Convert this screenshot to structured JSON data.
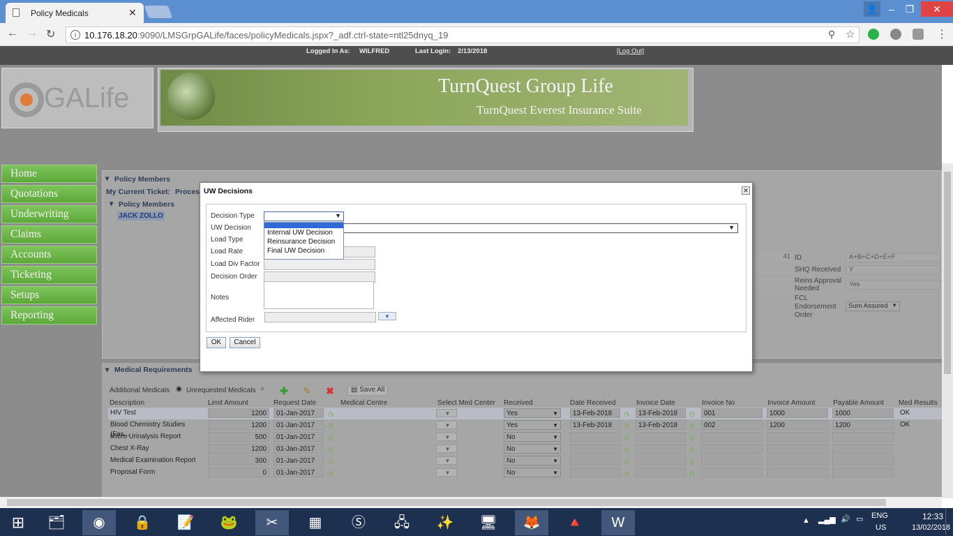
{
  "browser": {
    "tab_title": "Policy Medicals",
    "url_host": "10.176.18.20",
    "url_rest": ":9090/LMSGrpGALife/faces/policyMedicals.jspx?_adf.ctrl-state=ntl25dnyq_19"
  },
  "header": {
    "logged_in_label": "Logged In As:",
    "user": "WILFRED",
    "last_login_label": "Last Login:",
    "last_login": "2/13/2018",
    "logout": "[Log Out]",
    "logo_text": "GALife",
    "banner_title": "TurnQuest Group Life",
    "banner_sub": "TurnQuest Everest Insurance Suite"
  },
  "sidebar": {
    "items": [
      "Home",
      "Quotations",
      "Underwriting",
      "Claims",
      "Accounts",
      "Ticketing",
      "Setups",
      "Reporting"
    ]
  },
  "panel": {
    "title": "Policy Members",
    "ticket_label": "My Current Ticket:",
    "ticket_value": "Process",
    "members_title": "Policy Members",
    "member": "JACK ZOLLO",
    "right_fields": {
      "val41": "41",
      "id_label": "ID",
      "id_value": "A+B+C+D+E+F",
      "shq_label": "SHQ Received",
      "shq_value": "Y",
      "reins_label": "Reins Approval Needed",
      "reins_value": "Yes",
      "fcl_label": "FCL Endorsement Order",
      "fcl_value": "Sum Assured"
    }
  },
  "medical": {
    "title": "Medical Requirements",
    "additional": "Additional Medicals",
    "unrequested": "Unrequested Medicals",
    "save_all": "Save All",
    "columns": [
      "Description",
      "Limit Amount",
      "Request Date",
      "Medical Centre",
      "Select Med Center",
      "Received",
      "Date Received",
      "Invoice Date",
      "Invoice No",
      "Invoice Amount",
      "Payable Amount",
      "Med Results"
    ],
    "rows": [
      {
        "desc": "HIV Test",
        "limit": "1200",
        "req": "01-Jan-2017",
        "recv": "Yes",
        "drecv": "13-Feb-2018",
        "inv_date": "13-Feb-2018",
        "inv_no": "001",
        "inv_amt": "1000",
        "pay": "1000",
        "res": "OK"
      },
      {
        "desc": "Blood Chemistry Studies (Fas...",
        "limit": "1200",
        "req": "01-Jan-2017",
        "recv": "Yes",
        "drecv": "13-Feb-2018",
        "inv_date": "13-Feb-2018",
        "inv_no": "002",
        "inv_amt": "1200",
        "pay": "1200",
        "res": "OK"
      },
      {
        "desc": "Micro Urinalysis Report",
        "limit": "500",
        "req": "01-Jan-2017",
        "recv": "No",
        "drecv": "",
        "inv_date": "",
        "inv_no": "",
        "inv_amt": "",
        "pay": "",
        "res": ""
      },
      {
        "desc": "Chest X-Ray",
        "limit": "1200",
        "req": "01-Jan-2017",
        "recv": "No",
        "drecv": "",
        "inv_date": "",
        "inv_no": "",
        "inv_amt": "",
        "pay": "",
        "res": ""
      },
      {
        "desc": "Medical Examination Report",
        "limit": "300",
        "req": "01-Jan-2017",
        "recv": "No",
        "drecv": "",
        "inv_date": "",
        "inv_no": "",
        "inv_amt": "",
        "pay": "",
        "res": ""
      },
      {
        "desc": "Proposal Form",
        "limit": "0",
        "req": "01-Jan-2017",
        "recv": "No",
        "drecv": "",
        "inv_date": "",
        "inv_no": "",
        "inv_amt": "",
        "pay": "",
        "res": ""
      }
    ]
  },
  "dialog": {
    "title": "UW Decisions",
    "labels": {
      "decision_type": "Decision Type",
      "uw_decision": "UW Decision",
      "load_type": "Load Type",
      "load_rate": "Load Rate",
      "load_div": "Load Div Factor",
      "decision_order": "Decision Order",
      "notes": "Notes",
      "affected_rider": "Affected Rider"
    },
    "options": [
      "Internal UW Decision",
      "Reinsurance Decision",
      "Final UW Decision"
    ],
    "ok": "OK",
    "cancel": "Cancel"
  },
  "taskbar": {
    "lang": "ENG",
    "region": "US",
    "time": "12:33",
    "date": "13/02/2018"
  }
}
